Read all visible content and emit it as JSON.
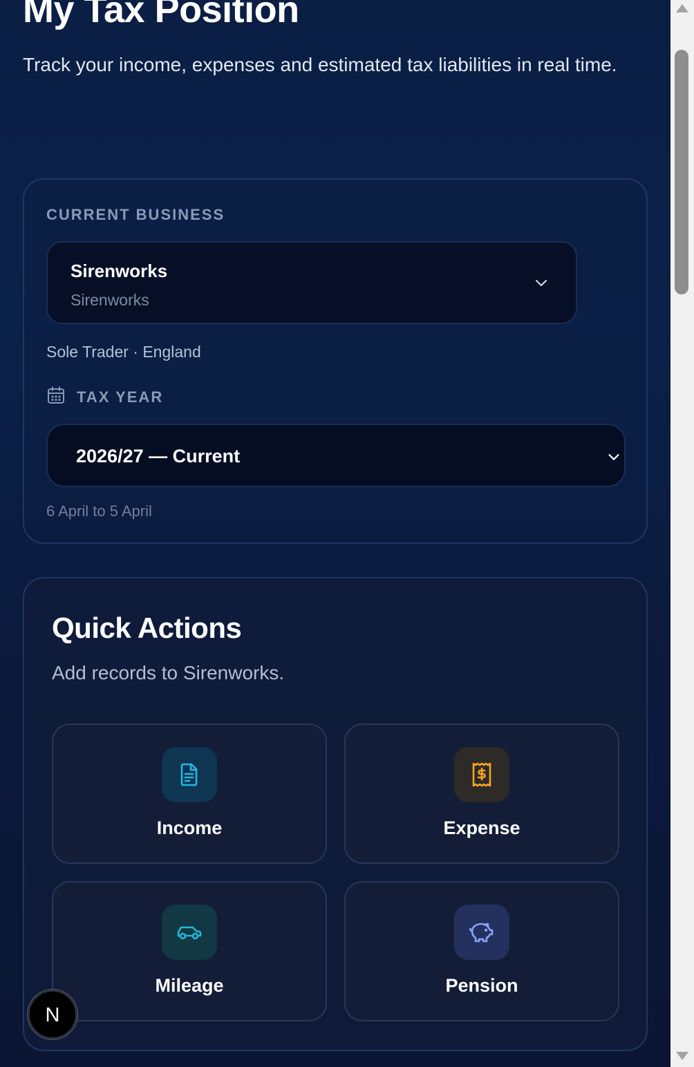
{
  "header": {
    "title": "My Tax Position",
    "subtitle": "Track your income, expenses and estimated tax liabilities in real time."
  },
  "business": {
    "section_label": "CURRENT BUSINESS",
    "selected_name": "Sirenworks",
    "selected_sub": "Sirenworks",
    "meta": "Sole Trader · England",
    "icons": {
      "dropdown": "chevron-down-icon"
    }
  },
  "tax_year": {
    "section_label": "TAX YEAR",
    "selected": "2026/27 — Current",
    "range": "6 April to 5 April",
    "icons": {
      "label": "calendar-icon",
      "dropdown": "chevron-down-icon"
    }
  },
  "quick_actions": {
    "title": "Quick Actions",
    "subtitle": "Add records to Sirenworks.",
    "tiles": [
      {
        "label": "Income",
        "icon": "document-icon",
        "color": "#22b8e0"
      },
      {
        "label": "Expense",
        "icon": "receipt-icon",
        "color": "#f5a623"
      },
      {
        "label": "Mileage",
        "icon": "car-icon",
        "color": "#22b8d8"
      },
      {
        "label": "Pension",
        "icon": "piggy-bank-icon",
        "color": "#8ea2ff"
      }
    ]
  },
  "badge": {
    "letter": "N"
  },
  "colors": {
    "background": "#0b1e44",
    "card_border": "#1f3763",
    "select_bg": "#060f26",
    "muted_text": "#8a9bb8"
  }
}
